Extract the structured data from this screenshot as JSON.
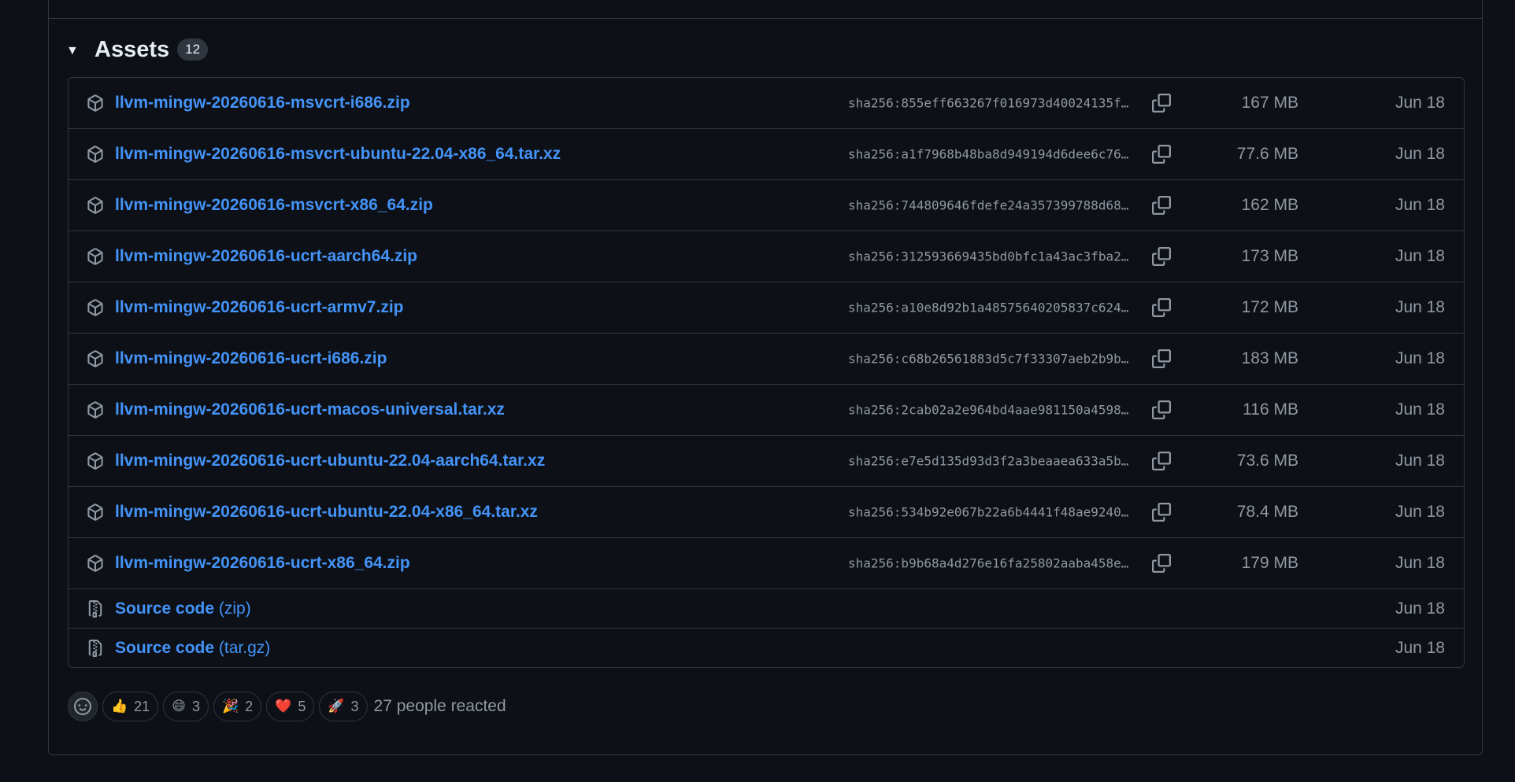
{
  "assets": {
    "title": "Assets",
    "count": "12",
    "items": [
      {
        "name": "llvm-mingw-20260616-msvcrt-i686.zip",
        "sha": "sha256:855eff663267f016973d40024135f…",
        "size": "167 MB",
        "date": "Jun 18"
      },
      {
        "name": "llvm-mingw-20260616-msvcrt-ubuntu-22.04-x86_64.tar.xz",
        "sha": "sha256:a1f7968b48ba8d949194d6dee6c76…",
        "size": "77.6 MB",
        "date": "Jun 18"
      },
      {
        "name": "llvm-mingw-20260616-msvcrt-x86_64.zip",
        "sha": "sha256:744809646fdefe24a357399788d68…",
        "size": "162 MB",
        "date": "Jun 18"
      },
      {
        "name": "llvm-mingw-20260616-ucrt-aarch64.zip",
        "sha": "sha256:312593669435bd0bfc1a43ac3fba2…",
        "size": "173 MB",
        "date": "Jun 18"
      },
      {
        "name": "llvm-mingw-20260616-ucrt-armv7.zip",
        "sha": "sha256:a10e8d92b1a48575640205837c624…",
        "size": "172 MB",
        "date": "Jun 18"
      },
      {
        "name": "llvm-mingw-20260616-ucrt-i686.zip",
        "sha": "sha256:c68b26561883d5c7f33307aeb2b9b…",
        "size": "183 MB",
        "date": "Jun 18"
      },
      {
        "name": "llvm-mingw-20260616-ucrt-macos-universal.tar.xz",
        "sha": "sha256:2cab02a2e964bd4aae981150a4598…",
        "size": "116 MB",
        "date": "Jun 18"
      },
      {
        "name": "llvm-mingw-20260616-ucrt-ubuntu-22.04-aarch64.tar.xz",
        "sha": "sha256:e7e5d135d93d3f2a3beaaea633a5b…",
        "size": "73.6 MB",
        "date": "Jun 18"
      },
      {
        "name": "llvm-mingw-20260616-ucrt-ubuntu-22.04-x86_64.tar.xz",
        "sha": "sha256:534b92e067b22a6b4441f48ae9240…",
        "size": "78.4 MB",
        "date": "Jun 18"
      },
      {
        "name": "llvm-mingw-20260616-ucrt-x86_64.zip",
        "sha": "sha256:b9b68a4d276e16fa25802aaba458e…",
        "size": "179 MB",
        "date": "Jun 18"
      }
    ],
    "sources": [
      {
        "label": "Source code",
        "format": "(zip)",
        "date": "Jun 18"
      },
      {
        "label": "Source code",
        "format": "(tar.gz)",
        "date": "Jun 18"
      }
    ]
  },
  "reactions": {
    "items": [
      {
        "emoji": "👍",
        "count": "21"
      },
      {
        "emoji": "😄",
        "count": "3"
      },
      {
        "emoji": "🎉",
        "count": "2"
      },
      {
        "emoji": "❤️",
        "count": "5"
      },
      {
        "emoji": "🚀",
        "count": "3"
      }
    ],
    "summary": "27 people reacted"
  },
  "colors": {
    "background": "#0d1117",
    "border": "#30363d",
    "link": "#4493f8",
    "muted": "#9198a1"
  }
}
